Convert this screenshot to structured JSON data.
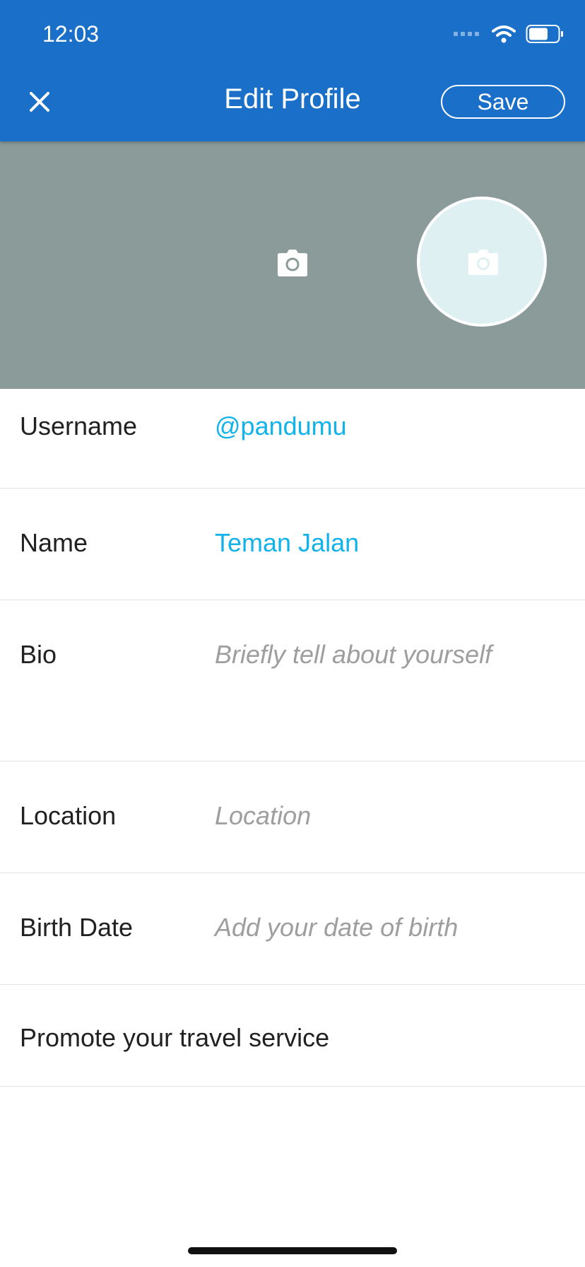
{
  "status_bar": {
    "time": "12:03"
  },
  "nav": {
    "title": "Edit Profile",
    "save_label": "Save"
  },
  "fields": {
    "username": {
      "label": "Username",
      "value": "@pandumu"
    },
    "name": {
      "label": "Name",
      "value": "Teman Jalan"
    },
    "bio": {
      "label": "Bio",
      "placeholder": "Briefly tell about yourself"
    },
    "location": {
      "label": "Location",
      "placeholder": "Location"
    },
    "birth_date": {
      "label": "Birth Date",
      "placeholder": "Add your date of birth"
    }
  },
  "promote": {
    "label": "Promote your travel service"
  },
  "colors": {
    "header": "#1a70c9",
    "cover": "#8a9b9a",
    "avatar": "#dff0f2",
    "link_value": "#12b2ea",
    "placeholder": "#9e9e9e"
  },
  "icons": {
    "close": "close-icon",
    "cover_camera": "camera-icon",
    "avatar_camera": "camera-icon",
    "wifi": "wifi-icon",
    "battery": "battery-icon",
    "signal": "signal-icon"
  }
}
